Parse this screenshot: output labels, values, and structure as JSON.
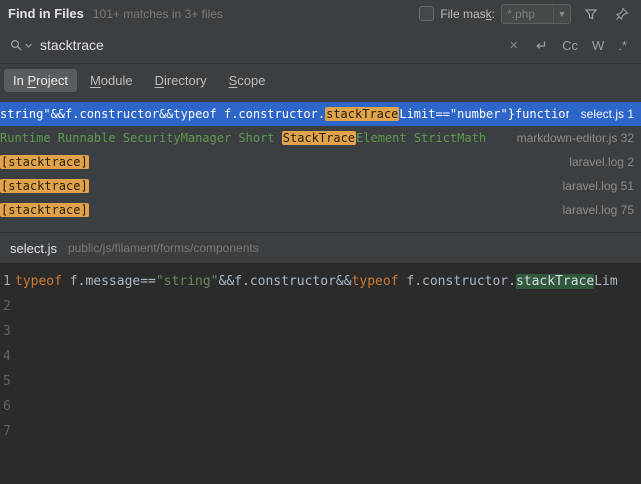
{
  "window": {
    "title": "Find in Files",
    "summary": "101+ matches in 3+ files"
  },
  "file_mask": {
    "label": "File mask:",
    "mnemonic": "k",
    "value": "*.php",
    "checked": false
  },
  "search": {
    "query": "stacktrace",
    "clear_label": "×",
    "match_case_label": "Cc",
    "words_label": "W",
    "regex_label": ".*"
  },
  "tabs": [
    {
      "label": "In Project",
      "mnemonic": "P",
      "selected": true
    },
    {
      "label": "Module",
      "mnemonic": "M",
      "selected": false
    },
    {
      "label": "Directory",
      "mnemonic": "D",
      "selected": false
    },
    {
      "label": "Scope",
      "mnemonic": "S",
      "selected": false
    }
  ],
  "results": [
    {
      "pre": "string\"&&f.constructor&&typeof f.constructor.",
      "match": "stackTrace",
      "post": "Limit==\"number\"}function n(",
      "file": "select.js",
      "line": "1",
      "selected": true,
      "style": "plain"
    },
    {
      "pre": "Runtime Runnable SecurityManager Short ",
      "match": "StackTrace",
      "post": "Element StrictMath",
      "file": "markdown-editor.js",
      "line": "32",
      "selected": false,
      "style": "green"
    },
    {
      "pre": "",
      "match": "[stacktrace]",
      "post": "",
      "file": "laravel.log",
      "line": "2",
      "selected": false,
      "style": "plain"
    },
    {
      "pre": "",
      "match": "[stacktrace]",
      "post": "",
      "file": "laravel.log",
      "line": "51",
      "selected": false,
      "style": "plain"
    },
    {
      "pre": "",
      "match": "[stacktrace]",
      "post": "",
      "file": "laravel.log",
      "line": "75",
      "selected": false,
      "style": "plain"
    }
  ],
  "preview": {
    "file": "select.js",
    "path": "public/js/filament/forms/components",
    "line_numbers": [
      "1",
      "2",
      "3",
      "4",
      "5",
      "6",
      "7"
    ],
    "code_tokens": [
      {
        "text": "typeof",
        "type": "keyword"
      },
      {
        "text": " f.message==",
        "type": "plain"
      },
      {
        "text": "\"string\"",
        "type": "string"
      },
      {
        "text": "&&f.constructor&&",
        "type": "plain"
      },
      {
        "text": "typeof",
        "type": "keyword"
      },
      {
        "text": " f.constructor.",
        "type": "plain"
      },
      {
        "text": "stackTrace",
        "type": "match"
      },
      {
        "text": "Lim",
        "type": "plain"
      }
    ]
  },
  "colors": {
    "panel_bg": "#3c3f41",
    "editor_bg": "#2b2b2b",
    "selected_row": "#2e65c9",
    "match_highlight": "#e0a24a",
    "editor_match": "#32593d",
    "green_text": "#5f9950",
    "keyword": "#cc7832",
    "string": "#6a8759"
  }
}
